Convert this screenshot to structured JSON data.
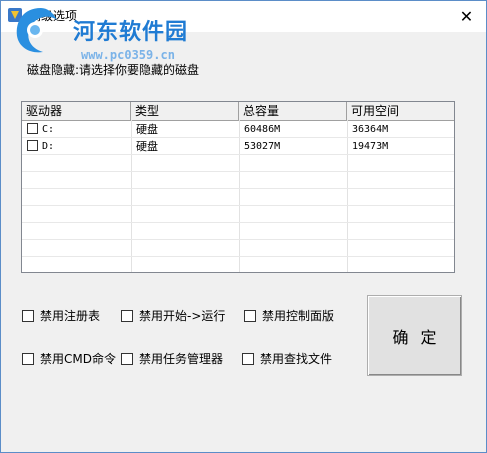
{
  "window": {
    "title": "高级选项",
    "close_glyph": "✕"
  },
  "watermark": {
    "brand": "河东软件园",
    "url": "www.pc0359.cn"
  },
  "prompt": "磁盘隐藏:请选择你要隐藏的磁盘",
  "drive_list": {
    "columns": [
      "驱动器",
      "类型",
      "总容量",
      "可用空间"
    ],
    "rows": [
      {
        "drive": "C:",
        "type": "硬盘",
        "total": "60486M",
        "free": "36364M",
        "checked": false
      },
      {
        "drive": "D:",
        "type": "硬盘",
        "total": "53027M",
        "free": "19473M",
        "checked": false
      }
    ]
  },
  "options": [
    {
      "label": "禁用注册表",
      "checked": false
    },
    {
      "label": "禁用开始->运行",
      "checked": false
    },
    {
      "label": "禁用控制面版",
      "checked": false
    },
    {
      "label": "禁用CMD命令",
      "checked": false
    },
    {
      "label": "禁用任务管理器",
      "checked": false
    },
    {
      "label": "禁用查找文件",
      "checked": false
    }
  ],
  "ok_button": "确定",
  "colors": {
    "brand_blue": "#1f7bd3",
    "window_border": "#5b8dc8",
    "dialog_bg": "#f0f0f0"
  }
}
